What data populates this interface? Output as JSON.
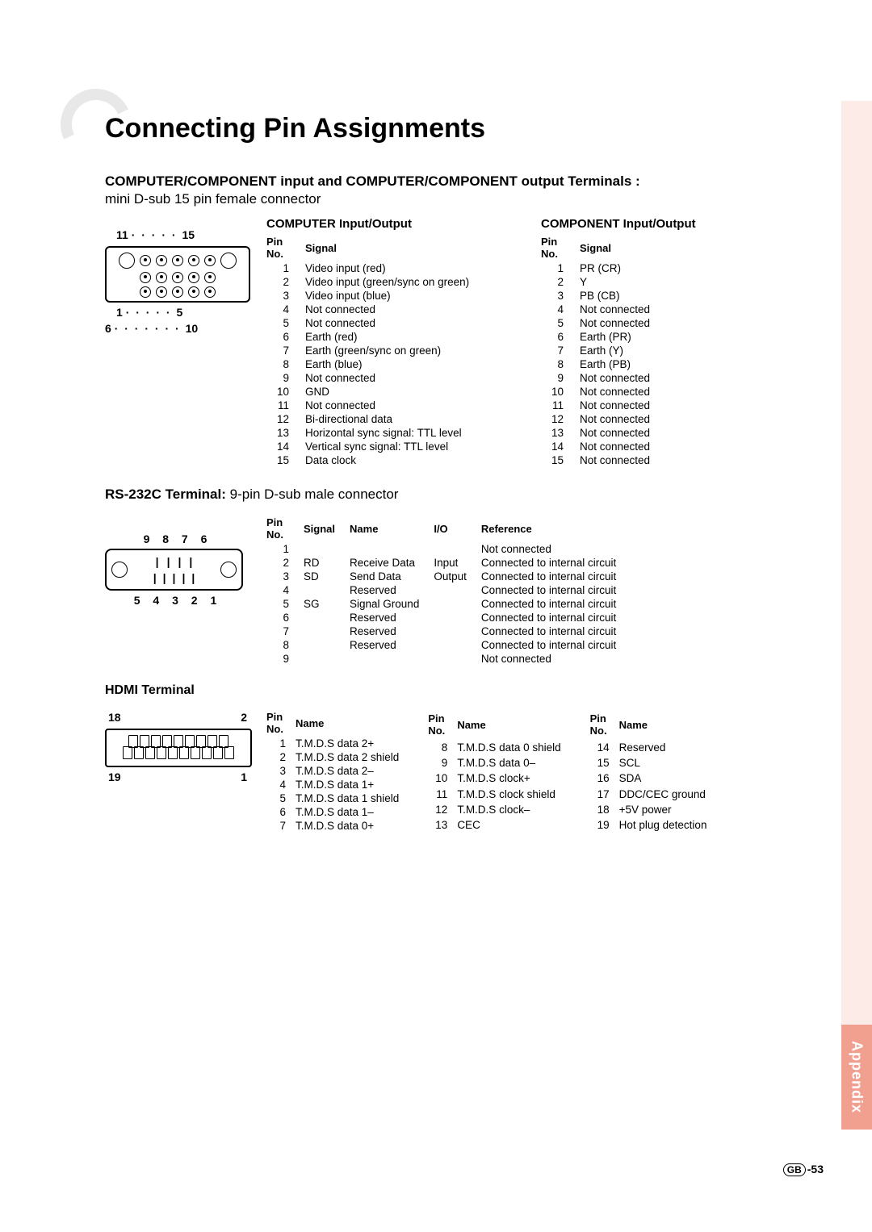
{
  "sidebar": {
    "appendix": "Appendix"
  },
  "title": "Connecting Pin Assignments",
  "section1": {
    "heading": "COMPUTER/COMPONENT input and COMPUTER/COMPONENT output Terminals :",
    "sub": "mini D-sub 15 pin female connector",
    "diagram": {
      "tl": "11",
      "tr": "15",
      "bl": "1",
      "br": "5",
      "b2l": "6",
      "b2r": "10"
    },
    "computer": {
      "title": "COMPUTER Input/Output",
      "h1": "Pin No.",
      "h2": "Signal",
      "rows": [
        {
          "n": "1",
          "s": "Video input (red)"
        },
        {
          "n": "2",
          "s": "Video input (green/sync on green)"
        },
        {
          "n": "3",
          "s": "Video input (blue)"
        },
        {
          "n": "4",
          "s": "Not connected"
        },
        {
          "n": "5",
          "s": "Not connected"
        },
        {
          "n": "6",
          "s": "Earth (red)"
        },
        {
          "n": "7",
          "s": "Earth (green/sync on green)"
        },
        {
          "n": "8",
          "s": "Earth (blue)"
        },
        {
          "n": "9",
          "s": "Not connected"
        },
        {
          "n": "10",
          "s": "GND"
        },
        {
          "n": "11",
          "s": "Not connected"
        },
        {
          "n": "12",
          "s": "Bi-directional data"
        },
        {
          "n": "13",
          "s": "Horizontal sync signal: TTL level"
        },
        {
          "n": "14",
          "s": "Vertical sync signal: TTL level"
        },
        {
          "n": "15",
          "s": "Data clock"
        }
      ]
    },
    "component": {
      "title": "COMPONENT Input/Output",
      "h1": "Pin No.",
      "h2": "Signal",
      "rows": [
        {
          "n": "1",
          "s": "PR (CR)"
        },
        {
          "n": "2",
          "s": "Y"
        },
        {
          "n": "3",
          "s": "PB (CB)"
        },
        {
          "n": "4",
          "s": "Not connected"
        },
        {
          "n": "5",
          "s": "Not connected"
        },
        {
          "n": "6",
          "s": "Earth (PR)"
        },
        {
          "n": "7",
          "s": "Earth (Y)"
        },
        {
          "n": "8",
          "s": "Earth (PB)"
        },
        {
          "n": "9",
          "s": "Not connected"
        },
        {
          "n": "10",
          "s": "Not connected"
        },
        {
          "n": "11",
          "s": "Not connected"
        },
        {
          "n": "12",
          "s": "Not connected"
        },
        {
          "n": "13",
          "s": "Not connected"
        },
        {
          "n": "14",
          "s": "Not connected"
        },
        {
          "n": "15",
          "s": "Not connected"
        }
      ]
    }
  },
  "section2": {
    "heading_bold": "RS-232C Terminal:",
    "heading_rest": " 9-pin D-sub male connector",
    "diagram": {
      "top": "9 8 7 6",
      "bot": "5 4 3 2 1"
    },
    "h1": "Pin No.",
    "h2": "Signal",
    "h3": "Name",
    "h4": "I/O",
    "h5": "Reference",
    "rows": [
      {
        "n": "1",
        "sig": "",
        "name": "",
        "io": "",
        "ref": "Not connected"
      },
      {
        "n": "2",
        "sig": "RD",
        "name": "Receive Data",
        "io": "Input",
        "ref": "Connected to internal circuit"
      },
      {
        "n": "3",
        "sig": "SD",
        "name": "Send Data",
        "io": "Output",
        "ref": "Connected to internal circuit"
      },
      {
        "n": "4",
        "sig": "",
        "name": "Reserved",
        "io": "",
        "ref": "Connected to internal circuit"
      },
      {
        "n": "5",
        "sig": "SG",
        "name": "Signal Ground",
        "io": "",
        "ref": "Connected to internal circuit"
      },
      {
        "n": "6",
        "sig": "",
        "name": "Reserved",
        "io": "",
        "ref": "Connected to internal circuit"
      },
      {
        "n": "7",
        "sig": "",
        "name": "Reserved",
        "io": "",
        "ref": "Connected to internal circuit"
      },
      {
        "n": "8",
        "sig": "",
        "name": "Reserved",
        "io": "",
        "ref": "Connected to internal circuit"
      },
      {
        "n": "9",
        "sig": "",
        "name": "",
        "io": "",
        "ref": "Not connected"
      }
    ]
  },
  "section3": {
    "heading": "HDMI Terminal",
    "diagram": {
      "tl": "18",
      "tr": "2",
      "bl": "19",
      "br": "1"
    },
    "h1": "Pin No.",
    "h2": "Name",
    "col1": [
      {
        "n": "1",
        "s": "T.M.D.S data 2+"
      },
      {
        "n": "2",
        "s": "T.M.D.S data 2 shield"
      },
      {
        "n": "3",
        "s": "T.M.D.S data 2–"
      },
      {
        "n": "4",
        "s": "T.M.D.S data 1+"
      },
      {
        "n": "5",
        "s": "T.M.D.S data 1 shield"
      },
      {
        "n": "6",
        "s": "T.M.D.S data 1–"
      },
      {
        "n": "7",
        "s": "T.M.D.S data 0+"
      }
    ],
    "col2": [
      {
        "n": "8",
        "s": "T.M.D.S data 0 shield"
      },
      {
        "n": "9",
        "s": "T.M.D.S data 0–"
      },
      {
        "n": "10",
        "s": "T.M.D.S clock+"
      },
      {
        "n": "11",
        "s": "T.M.D.S clock shield"
      },
      {
        "n": "12",
        "s": "T.M.D.S clock–"
      },
      {
        "n": "13",
        "s": "CEC"
      }
    ],
    "col3": [
      {
        "n": "14",
        "s": "Reserved"
      },
      {
        "n": "15",
        "s": "SCL"
      },
      {
        "n": "16",
        "s": "SDA"
      },
      {
        "n": "17",
        "s": "DDC/CEC ground"
      },
      {
        "n": "18",
        "s": "+5V power"
      },
      {
        "n": "19",
        "s": "Hot plug detection"
      }
    ]
  },
  "page": {
    "region": "GB",
    "num": "-53"
  }
}
